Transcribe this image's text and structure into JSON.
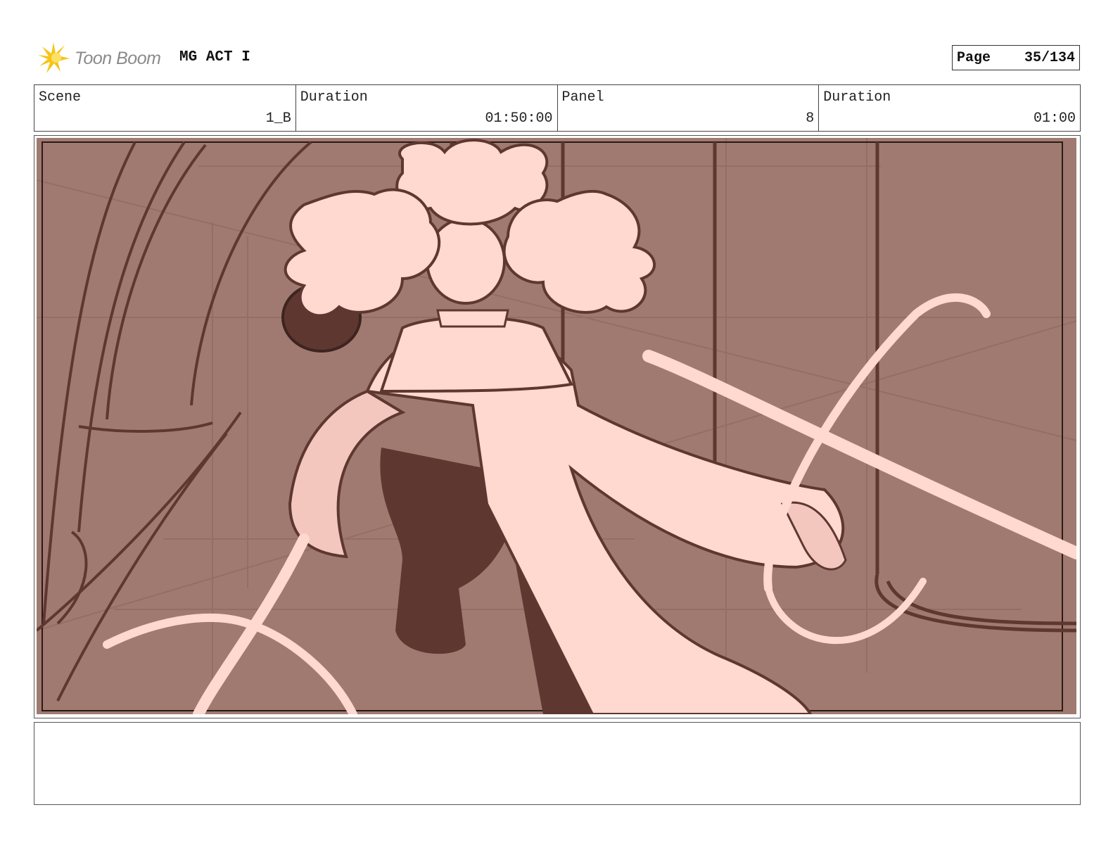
{
  "header": {
    "logo_text": "Toon Boom",
    "project_title": "MG ACT I",
    "page_label": "Page",
    "page_number": "35/134"
  },
  "info": {
    "scene_label": "Scene",
    "scene_value": "1_B",
    "scene_duration_label": "Duration",
    "scene_duration_value": "01:50:00",
    "panel_label": "Panel",
    "panel_value": "8",
    "panel_duration_label": "Duration",
    "panel_duration_value": "01:00"
  },
  "notes": {
    "text": ""
  },
  "colors": {
    "panel_background": "#a07a70",
    "line_color": "#5e3830",
    "highlight": "#ffd8cf",
    "logo_accent": "#f5c518"
  }
}
